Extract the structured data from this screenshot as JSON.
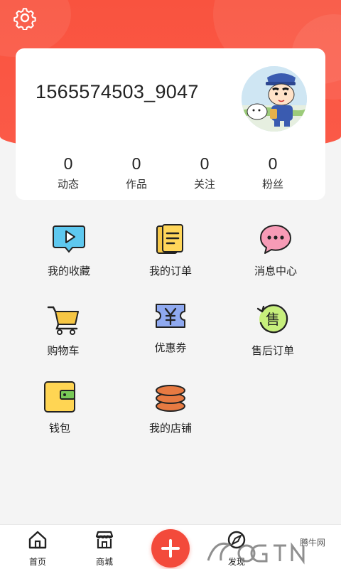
{
  "profile": {
    "username": "1565574503_9047",
    "stats": [
      {
        "value": "0",
        "label": "动态"
      },
      {
        "value": "0",
        "label": "作品"
      },
      {
        "value": "0",
        "label": "关注"
      },
      {
        "value": "0",
        "label": "粉丝"
      }
    ]
  },
  "menu": [
    {
      "label": "我的收藏",
      "icon": "video-favorites-icon"
    },
    {
      "label": "我的订单",
      "icon": "order-document-icon"
    },
    {
      "label": "消息中心",
      "icon": "chat-bubble-icon"
    },
    {
      "label": "购物车",
      "icon": "shopping-cart-icon"
    },
    {
      "label": "优惠券",
      "icon": "coupon-yen-icon"
    },
    {
      "label": "售后订单",
      "icon": "after-sales-icon"
    },
    {
      "label": "钱包",
      "icon": "wallet-icon"
    },
    {
      "label": "我的店铺",
      "icon": "coin-stack-icon"
    }
  ],
  "tabbar": {
    "home": "首页",
    "mall": "商城",
    "tab4": "发现"
  },
  "watermark": "腾牛网",
  "colors": {
    "accent": "#f9533f",
    "fab": "#f34a3b"
  }
}
